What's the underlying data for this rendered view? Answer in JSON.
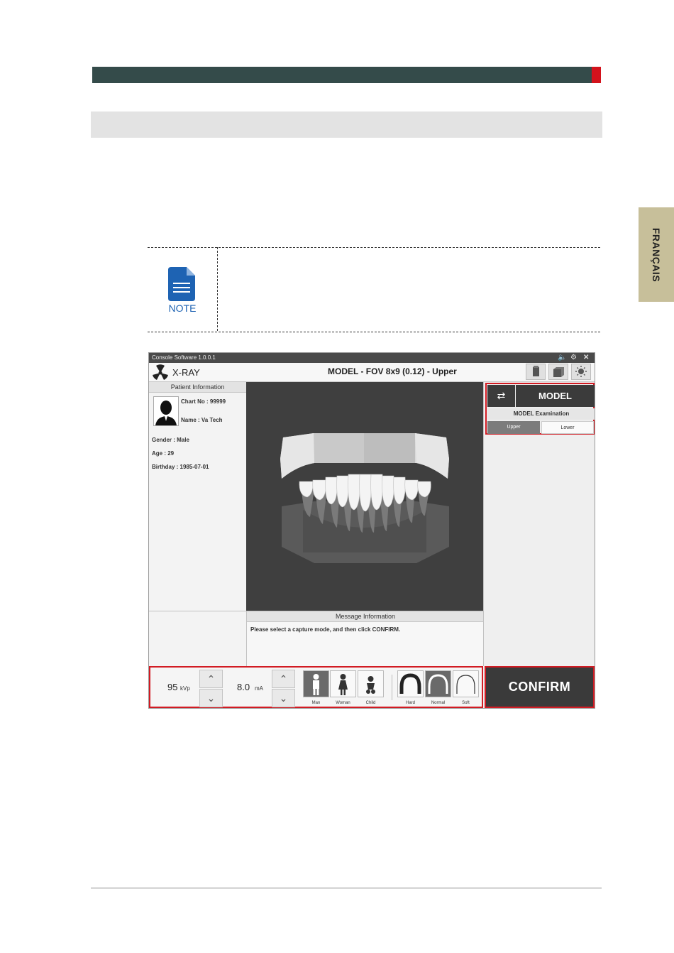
{
  "sidebar_tab": {
    "language": "FRANÇAIS"
  },
  "note": {
    "label": "NOTE"
  },
  "console": {
    "titlebar": {
      "title": "Console Software  1.0.0.1"
    },
    "header": {
      "mode": "X-RAY",
      "exam_title": "MODEL - FOV 8x9 (0.12) - Upper"
    },
    "patient": {
      "heading": "Patient Information",
      "chart_no": "Chart No : 99999",
      "name": "Name : Va Tech",
      "gender": "Gender : Male",
      "age": "Age : 29",
      "birthday": "Birthday : 1985-07-01"
    },
    "message": {
      "heading": "Message Information",
      "text": "Please select a capture mode, and then click CONFIRM."
    },
    "model_panel": {
      "model_label": "MODEL",
      "exam_label": "MODEL Examination",
      "upper_label": "Upper",
      "lower_label": "Lower"
    },
    "exposure": {
      "kvp_value": "95",
      "kvp_unit": "kVp",
      "ma_value": "8.0",
      "ma_unit": "mA",
      "patient_types": [
        "Man",
        "Woman",
        "Child"
      ],
      "patient_type_selected": "Man",
      "density": [
        "Hard",
        "Normal",
        "Soft"
      ],
      "density_selected": "Normal"
    },
    "confirm_label": "CONFIRM"
  },
  "colors": {
    "header_bar": "#344b4a",
    "accent_red": "#d3121c",
    "highlight_red": "#d21b23",
    "note_blue": "#1e63b3",
    "lang_tab": "#c7bf9a"
  }
}
